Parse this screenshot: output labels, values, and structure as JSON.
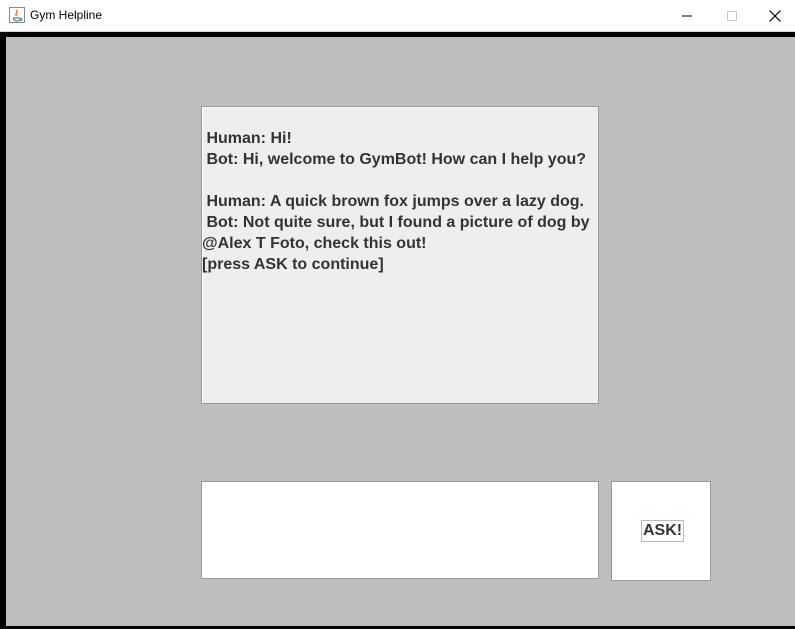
{
  "window": {
    "title": "Gym Helpline"
  },
  "chat": {
    "lines": [
      " Human: Hi!",
      " Bot: Hi, welcome to GymBot! How can I help you?",
      "",
      " Human: A quick brown fox jumps over a lazy dog.",
      " Bot: Not quite sure, but I found a picture of dog by",
      "@Alex T Foto, check this out!",
      "[press ASK to continue]"
    ]
  },
  "input": {
    "value": ""
  },
  "ask_button": {
    "label": "ASK!"
  },
  "colors": {
    "background": "#bebebe",
    "chat_background": "#eeeeee",
    "text": "#333333"
  },
  "icons": [
    "java-app-icon",
    "minimize-icon",
    "maximize-icon",
    "close-icon"
  ]
}
